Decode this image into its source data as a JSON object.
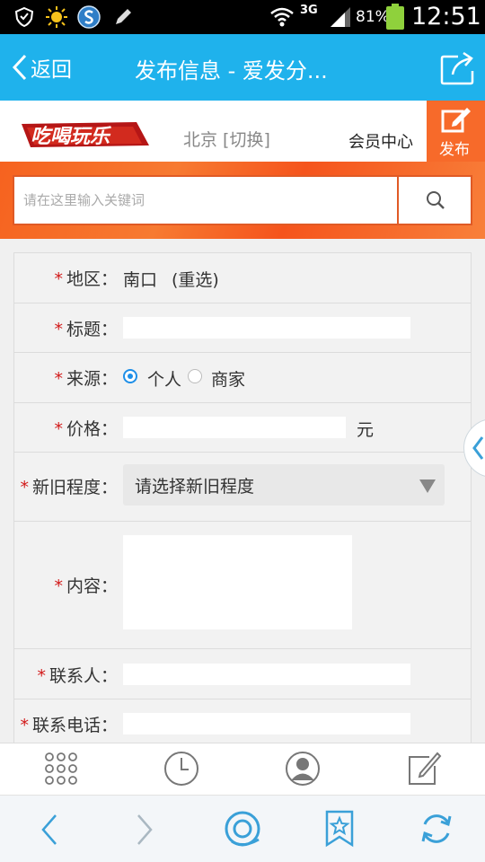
{
  "status_bar": {
    "network": "3G",
    "battery": "81%",
    "time": "12:51"
  },
  "titlebar": {
    "back_label": "返回",
    "title": "发布信息 - 爱发分..."
  },
  "site_header": {
    "logo_text": "吃喝玩乐",
    "city": "北京 [切换]",
    "member_center": "会员中心",
    "publish_label": "发布"
  },
  "search": {
    "placeholder": "请在这里输入关键词"
  },
  "form": {
    "region": {
      "label": "地区：",
      "value": "南口",
      "reselect": "(重选)"
    },
    "title": {
      "label": "标题：",
      "value": ""
    },
    "source": {
      "label": "来源：",
      "options": [
        "个人",
        "商家"
      ],
      "selected": "个人"
    },
    "price": {
      "label": "价格：",
      "value": "",
      "unit": "元"
    },
    "condition": {
      "label": "新旧程度：",
      "selected_text": "请选择新旧程度"
    },
    "content": {
      "label": "内容：",
      "value": ""
    },
    "contact": {
      "label": "联系人：",
      "value": ""
    },
    "phone": {
      "label": "联系电话：",
      "value": ""
    },
    "required_mark": "*"
  },
  "colors": {
    "titlebar": "#1fb2ec",
    "orange": "#f76a2a",
    "required": "#d21919",
    "toolbar_blue": "#3aa0d8"
  },
  "toolbar": {
    "icons": [
      "apps-grid-icon",
      "history-clock-icon",
      "user-avatar-icon",
      "edit-note-icon"
    ]
  },
  "browser_bar": {
    "icons": [
      "back-arrow-icon",
      "forward-arrow-icon",
      "browser-home-icon",
      "bookmark-star-icon",
      "refresh-icon"
    ]
  }
}
